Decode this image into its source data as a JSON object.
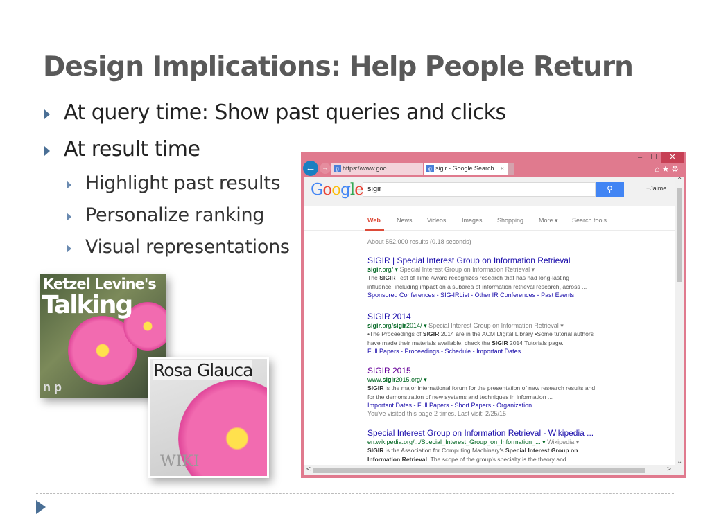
{
  "slide": {
    "title": "Design Implications: Help People Return",
    "bullets": [
      "At query time: Show past queries and clicks",
      "At result time"
    ],
    "sub_bullets": [
      "Highlight past results",
      "Personalize ranking",
      "Visual representations"
    ]
  },
  "images": {
    "talking_plants": {
      "line1": "Ketzel Levine's",
      "line2": "Talking",
      "logo": "n p"
    },
    "rosa_glauca": {
      "caption": "Rosa Glauca",
      "watermark": "WIKI"
    }
  },
  "browser": {
    "address": "https://www.goo...",
    "tab_title": "sigir - Google Search",
    "tab_close": "×",
    "back_icon": "←",
    "forward_icon": "→",
    "window_controls": {
      "minimize": "–",
      "maximize": "☐",
      "close": "✕"
    },
    "toolbar_icons": "⌂★⚙",
    "accent_color": "#e07a8e"
  },
  "google": {
    "logo": [
      "G",
      "o",
      "o",
      "g",
      "l",
      "e"
    ],
    "logo_colors": [
      "#4285f4",
      "#ea4335",
      "#fbbc05",
      "#4285f4",
      "#34a853",
      "#ea4335"
    ],
    "query": "sigir",
    "search_icon": "🔍",
    "user": "+Jaime",
    "nav": [
      "Web",
      "News",
      "Videos",
      "Images",
      "Shopping",
      "More ▾",
      "Search tools"
    ],
    "stats": "About 552,000 results (0.18 seconds)",
    "results": [
      {
        "title": "SIGIR | Special Interest Group on Information Retrieval",
        "visited": false,
        "url": [
          [
            "sigir",
            1
          ],
          [
            ".org/",
            0
          ]
        ],
        "url_extra": "Special Interest Group on Information Retrieval ▾",
        "snippet": [
          [
            [
              "The ",
              0
            ],
            [
              "SIGIR",
              1
            ],
            [
              " Test of Time Award recognizes research that has had long-lasting",
              0
            ]
          ],
          [
            [
              "influence, including impact on a subarea of information retrieval research, across ...",
              0
            ]
          ]
        ],
        "links": "Sponsored Conferences - SIG-IRList - Other IR Conferences - Past Events"
      },
      {
        "title": "SIGIR 2014",
        "visited": false,
        "url": [
          [
            "sigir",
            1
          ],
          [
            ".org/",
            0
          ],
          [
            "sigir",
            1
          ],
          [
            "2014/",
            0
          ]
        ],
        "url_extra": "Special Interest Group on Information Retrieval ▾",
        "snippet": [
          [
            [
              "•The Proceedings of ",
              0
            ],
            [
              "SIGIR",
              1
            ],
            [
              " 2014 are in the ACM Digital Library •Some tutorial authors",
              0
            ]
          ],
          [
            [
              "have made their materials available, check the ",
              0
            ],
            [
              "SIGIR",
              1
            ],
            [
              " 2014 Tutorials page.",
              0
            ]
          ]
        ],
        "links": "Full Papers - Proceedings - Schedule - Important Dates"
      },
      {
        "title": "SIGIR 2015",
        "visited": true,
        "url": [
          [
            "www.",
            0
          ],
          [
            "sigir",
            1
          ],
          [
            "2015.org/",
            0
          ]
        ],
        "url_extra": "",
        "snippet": [
          [
            [
              "SIGIR",
              1
            ],
            [
              " is the major international forum for the presentation of new research results and",
              0
            ]
          ],
          [
            [
              "for the demonstration of new systems and techniques in information ...",
              0
            ]
          ]
        ],
        "links": "Important Dates - Full Papers - Short Papers - Organization",
        "visit_note": "You've visited this page 2 times. Last visit: 2/25/15"
      },
      {
        "title": "Special Interest Group on Information Retrieval - Wikipedia ...",
        "visited": false,
        "url": [
          [
            "en.wikipedia.org/.../Special_Interest_Group_on_Information_...",
            0
          ]
        ],
        "url_extra": "Wikipedia ▾",
        "snippet": [
          [
            [
              "SIGIR",
              1
            ],
            [
              " is the Association for Computing Machinery's ",
              0
            ],
            [
              "Special Interest Group on",
              1
            ]
          ],
          [
            [
              "Information Retrieval",
              1
            ],
            [
              ". The scope of the group's specialty is the theory and ...",
              0
            ]
          ]
        ],
        "links": ""
      }
    ]
  }
}
